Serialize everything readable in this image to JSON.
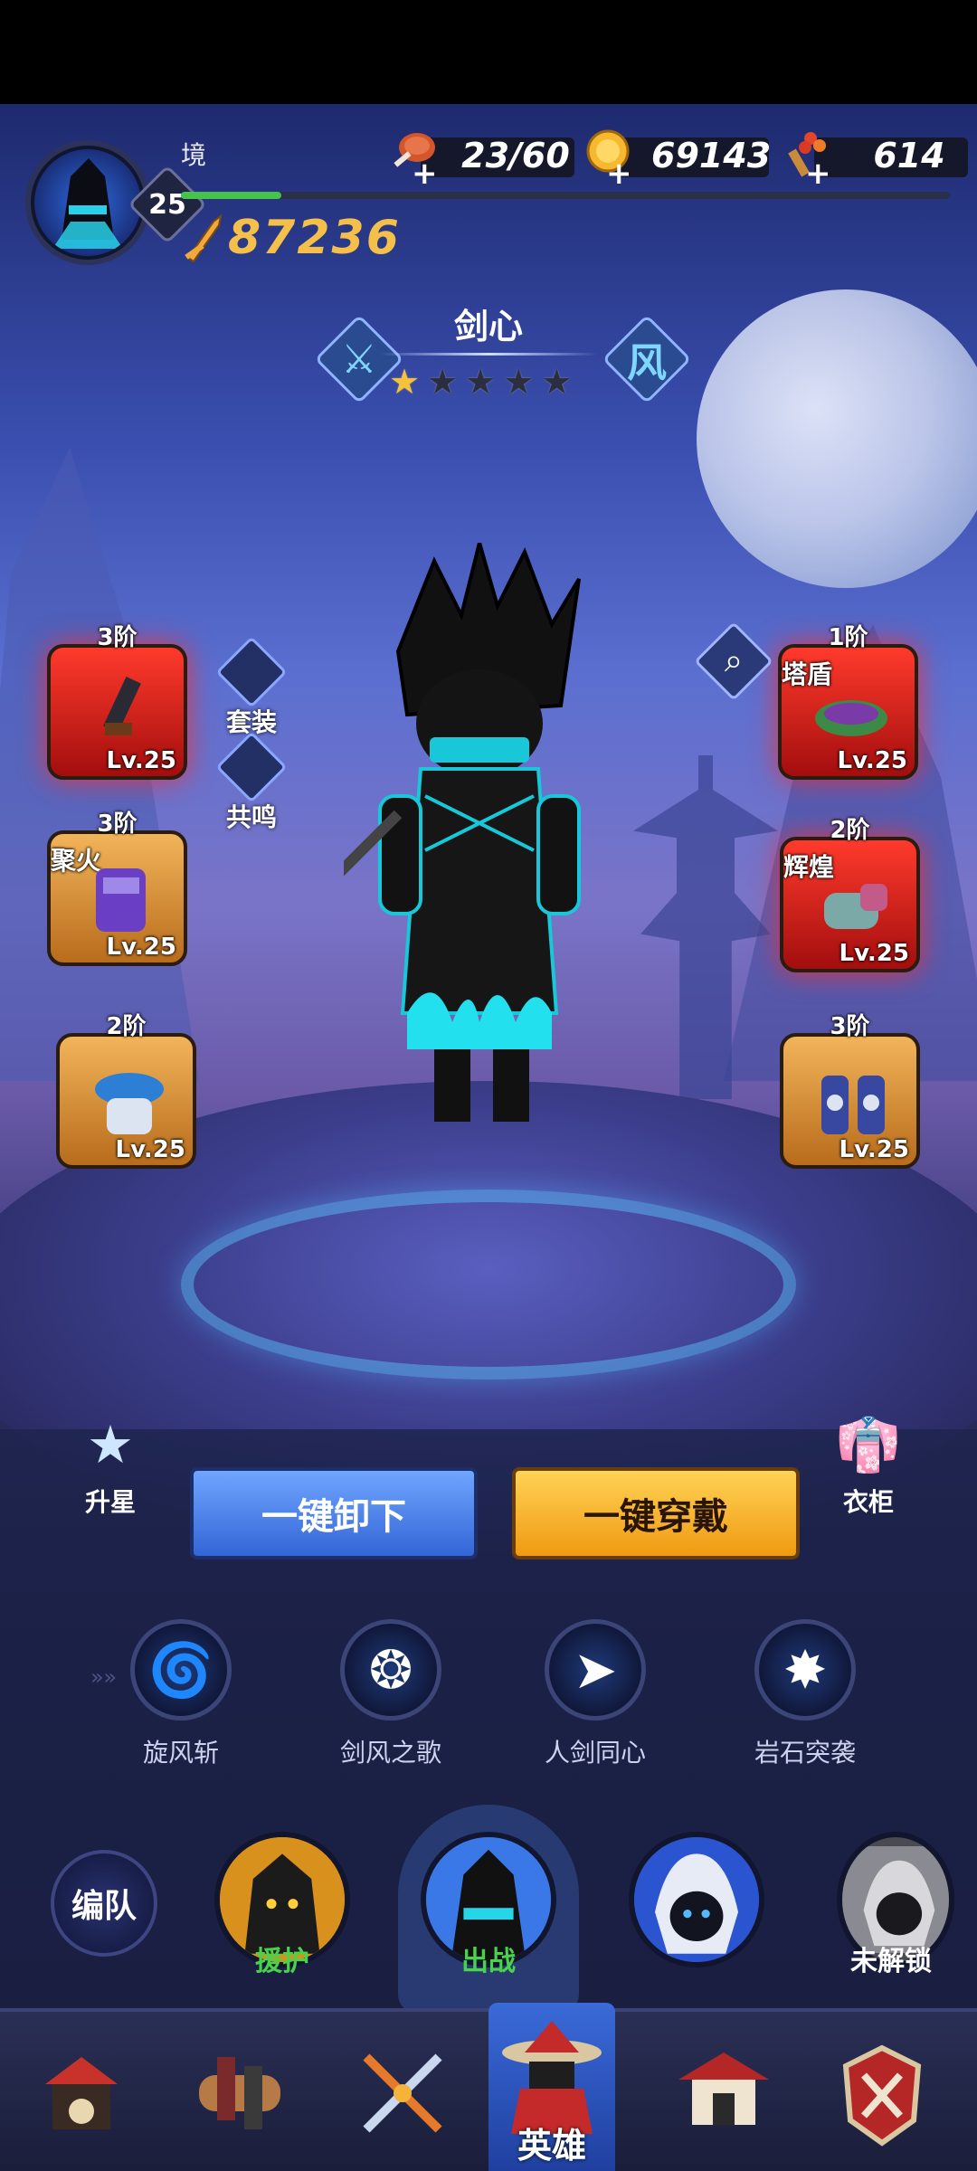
{
  "player": {
    "name": "境",
    "level": "25",
    "xp_fraction": 0.13,
    "power": "87236"
  },
  "resources": [
    {
      "icon": "meat-stamina-icon",
      "value": "23/60",
      "plus": "+"
    },
    {
      "icon": "gold-coin-icon",
      "value": "69143",
      "plus": "+"
    },
    {
      "icon": "herb-bundle-icon",
      "value": "614",
      "plus": "+"
    }
  ],
  "hero": {
    "name": "剑心",
    "stars_total": 5,
    "stars_filled": 1,
    "element_glyph": "风"
  },
  "equipment": {
    "left": [
      {
        "tier": "3阶",
        "name": "",
        "level": "Lv.25",
        "style": "red",
        "icon": "blade-weapon-icon"
      },
      {
        "tier": "3阶",
        "name": "聚火",
        "level": "Lv.25",
        "style": "gold",
        "icon": "purple-armor-icon"
      },
      {
        "tier": "2阶",
        "name": "",
        "level": "Lv.25",
        "style": "gold",
        "icon": "shoulder-guard-icon"
      }
    ],
    "right": [
      {
        "tier": "1阶",
        "name": "塔盾",
        "level": "Lv.25",
        "style": "red",
        "icon": "belt-icon"
      },
      {
        "tier": "2阶",
        "name": "辉煌",
        "level": "Lv.25",
        "style": "red",
        "icon": "gauntlet-icon"
      },
      {
        "tier": "3阶",
        "name": "",
        "level": "Lv.25",
        "style": "gold",
        "icon": "boots-icon"
      }
    ]
  },
  "mini_buttons": {
    "set_label": "套装",
    "resonance_label": "共鸣"
  },
  "actions": {
    "unequip_all": "一键卸下",
    "equip_all": "一键穿戴",
    "star_up": "升星",
    "wardrobe": "衣柜"
  },
  "skills": [
    {
      "label": "旋风斩",
      "icon": "whirlwind-icon"
    },
    {
      "label": "剑风之歌",
      "icon": "wind-song-icon"
    },
    {
      "label": "人剑同心",
      "icon": "blade-unity-icon"
    },
    {
      "label": "岩石突袭",
      "icon": "rock-strike-icon"
    }
  ],
  "roster": {
    "team_label": "编队",
    "slots": [
      {
        "label": "援护",
        "color": "#49d24c"
      },
      {
        "label": "出战",
        "color": "#49d24c"
      },
      {
        "label": "",
        "color": "#ffffff"
      },
      {
        "label": "未解锁",
        "color": "#ffffff"
      }
    ]
  },
  "navbar": {
    "items": [
      {
        "icon": "shop-icon",
        "label": ""
      },
      {
        "icon": "scroll-icon",
        "label": ""
      },
      {
        "icon": "weapons-icon",
        "label": ""
      },
      {
        "icon": "hero-icon",
        "label": "英雄"
      },
      {
        "icon": "dojo-icon",
        "label": ""
      },
      {
        "icon": "battle-icon",
        "label": ""
      }
    ]
  }
}
